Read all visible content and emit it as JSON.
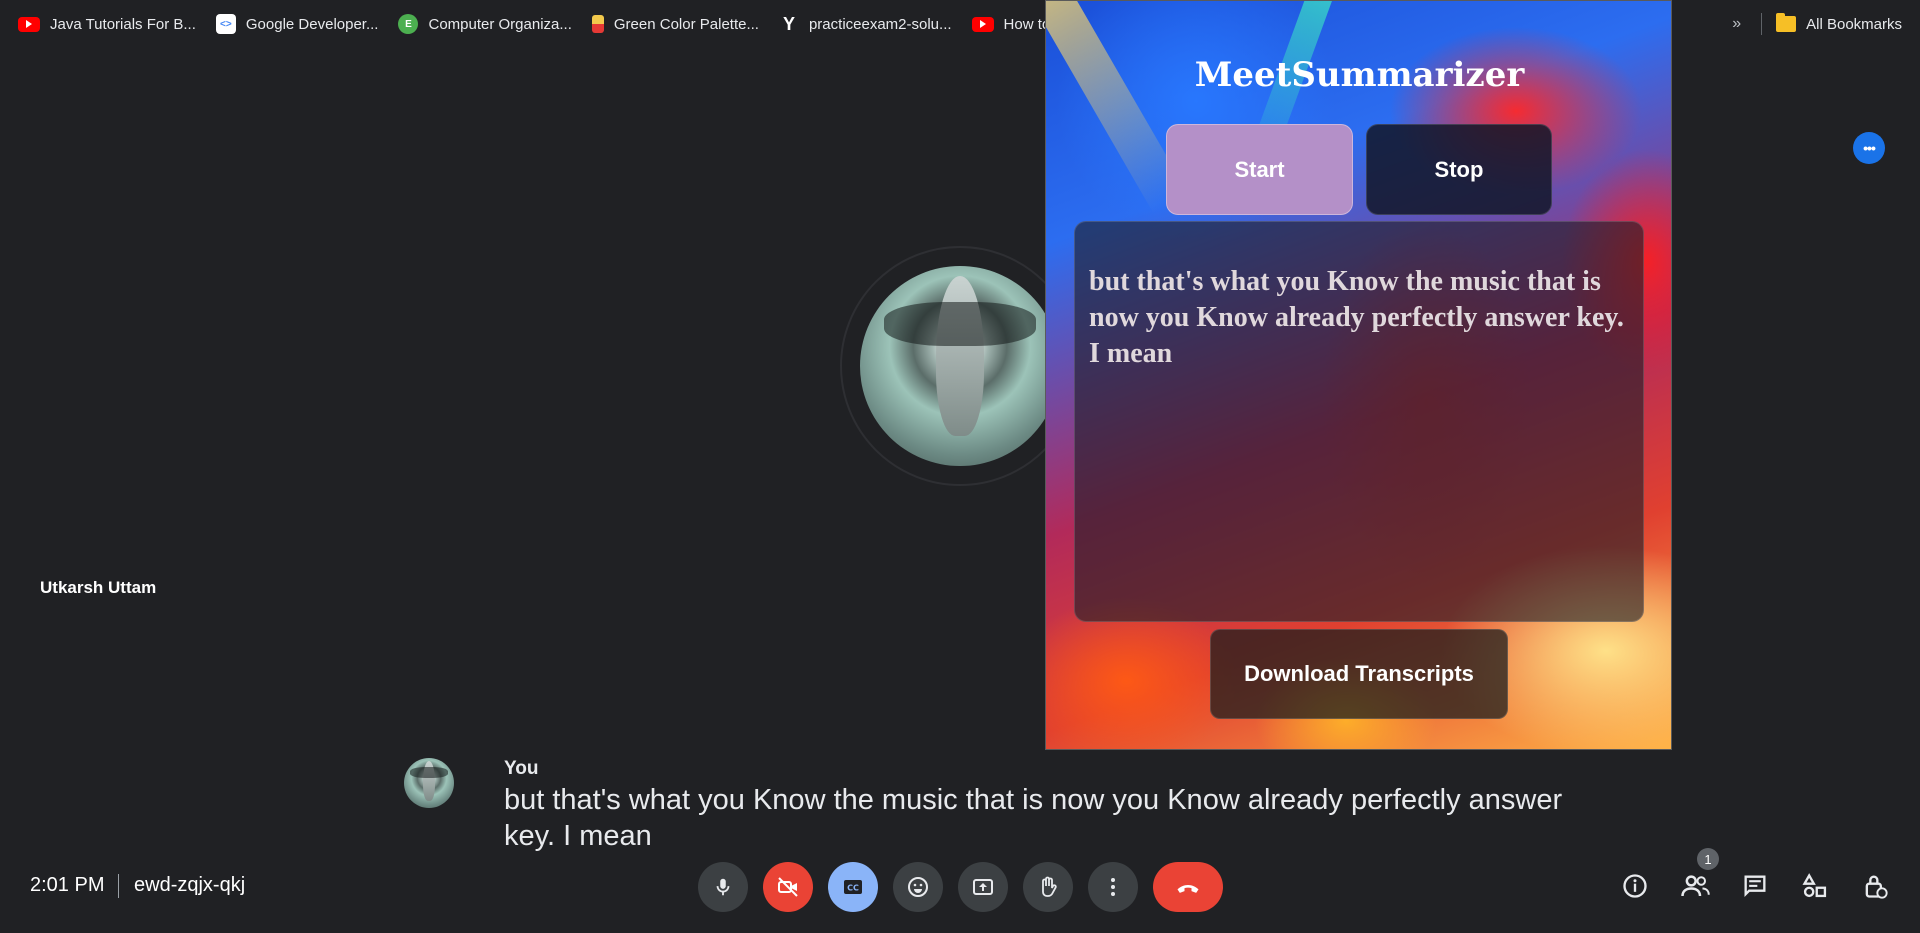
{
  "bookmarks": [
    {
      "label": "Java Tutorials For B...",
      "icon": "youtube-icon"
    },
    {
      "label": "Google Developer...",
      "icon": "google-developers-icon"
    },
    {
      "label": "Computer Organiza...",
      "icon": "site-icon"
    },
    {
      "label": "Green Color Palette...",
      "icon": "palette-icon"
    },
    {
      "label": "practiceexam2-solu...",
      "icon": "y-icon"
    },
    {
      "label": "How to C",
      "icon": "youtube-icon"
    }
  ],
  "bookmarks_right": {
    "overflow": "»",
    "all_bookmarks": "All Bookmarks"
  },
  "meeting": {
    "participant_name": "Utkarsh Uttam",
    "caption_speaker": "You",
    "caption_text": "but that's what you Know the music that is now you Know already perfectly answer key. I mean",
    "time": "2:01 PM",
    "meeting_code": "ewd-zqjx-qkj",
    "people_count": "1",
    "more_dots": "•••"
  },
  "extension": {
    "title": "MeetSummarizer",
    "start_label": "Start",
    "stop_label": "Stop",
    "transcript": "but that's what you Know the music that is now you Know already perfectly answer key. I mean",
    "download_label": "Download Transcripts"
  },
  "colors": {
    "background": "#202124",
    "end_call": "#ea4335",
    "captions_active": "#8ab4f8",
    "start_button": "#b490c8",
    "more_button": "#1a73e8"
  }
}
